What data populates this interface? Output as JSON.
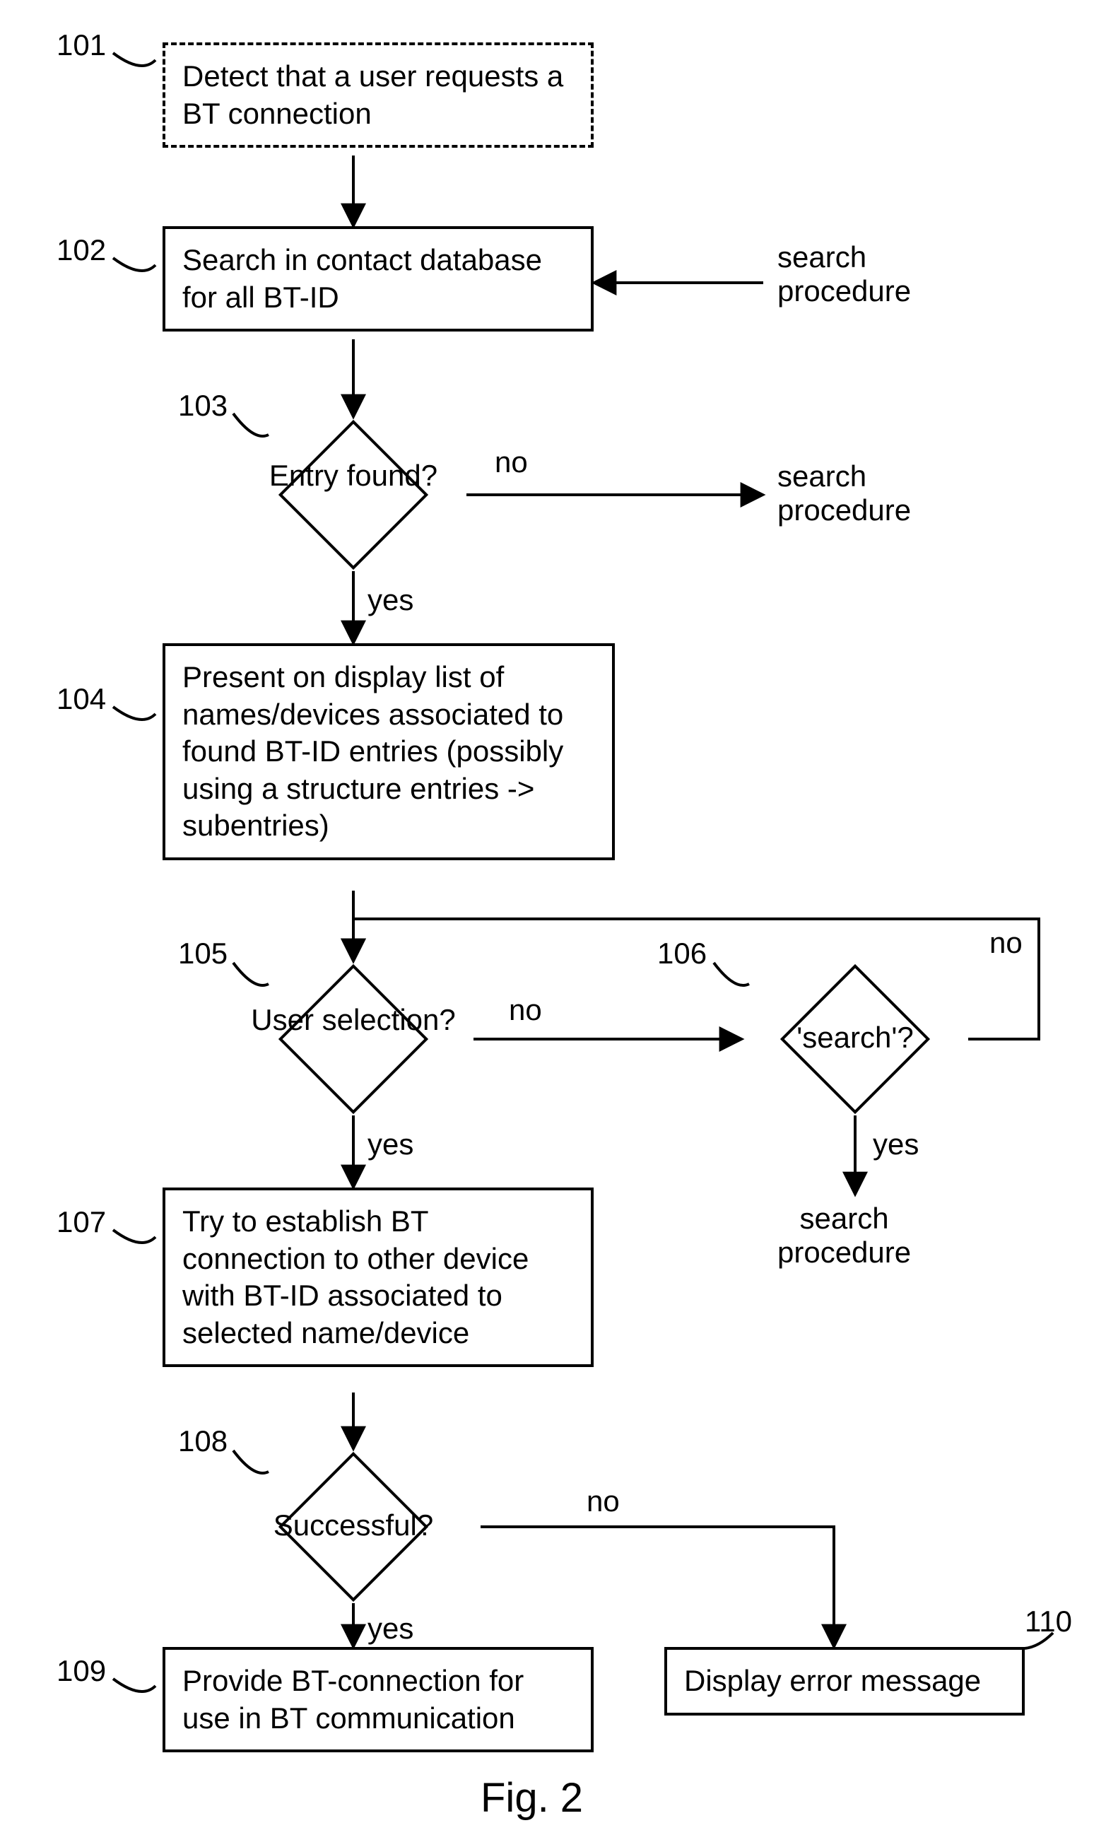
{
  "labels": {
    "n101": "101",
    "n102": "102",
    "n103": "103",
    "n104": "104",
    "n105": "105",
    "n106": "106",
    "n107": "107",
    "n108": "108",
    "n109": "109",
    "n110": "110"
  },
  "nodes": {
    "b101": "Detect that a user requests a BT connection",
    "b102": "Search in contact database for all BT-ID",
    "d103": "Entry found?",
    "b104": "Present on display list of names/devices associated to found BT-ID entries (possibly using a structure entries -> subentries)",
    "d105": "User selection?",
    "d106": "'search'?",
    "b107": "Try to establish BT connection to other device with BT-ID associated to selected name/device",
    "d108": "Successful?",
    "b109": "Provide BT-connection for use in BT communication",
    "b110": "Display error message"
  },
  "edges": {
    "yes": "yes",
    "no": "no",
    "searchproc": "search\nprocedure"
  },
  "figure": "Fig. 2"
}
